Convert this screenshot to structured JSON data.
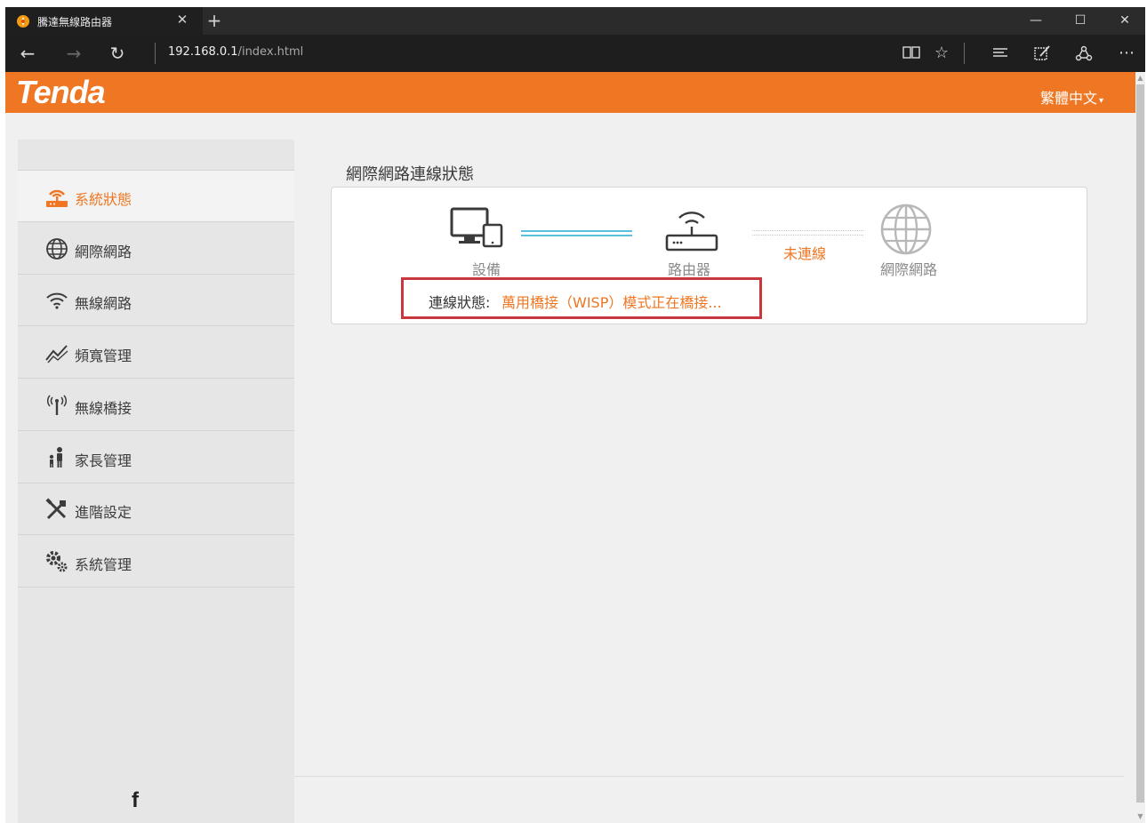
{
  "browser": {
    "tab_title": "騰達無線路由器",
    "tab_close": "✕",
    "new_tab": "+",
    "url_host": "192.168.0.1",
    "url_path": "/index.html",
    "window_buttons": {
      "minimize": "—",
      "maximize": "☐",
      "close": "✕"
    }
  },
  "header": {
    "logo": "Tenda",
    "language": "繁體中文",
    "language_caret": "▾"
  },
  "sidebar": {
    "items": [
      {
        "label": "系統狀態",
        "icon": "router-status-icon",
        "active": true
      },
      {
        "label": "網際網路",
        "icon": "globe-icon",
        "active": false
      },
      {
        "label": "無線網路",
        "icon": "wifi-icon",
        "active": false
      },
      {
        "label": "頻寬管理",
        "icon": "bandwidth-icon",
        "active": false
      },
      {
        "label": "無線橋接",
        "icon": "antenna-icon",
        "active": false
      },
      {
        "label": "家長管理",
        "icon": "parent-child-icon",
        "active": false
      },
      {
        "label": "進階設定",
        "icon": "tools-icon",
        "active": false
      },
      {
        "label": "系統管理",
        "icon": "gears-icon",
        "active": false
      }
    ],
    "footer_icon": "facebook-icon",
    "footer_text": "f"
  },
  "main": {
    "section_title": "網際網路連線狀態",
    "nodes": {
      "device": "設備",
      "router": "路由器",
      "internet": "網際網路"
    },
    "wan_status": "未連線",
    "connection_label": "連線狀態:",
    "connection_value": "萬用橋接（WISP）模式正在橋接..."
  },
  "colors": {
    "accent": "#ef7622",
    "highlight_border": "#c8373c",
    "link_line": "#5bc0de"
  }
}
